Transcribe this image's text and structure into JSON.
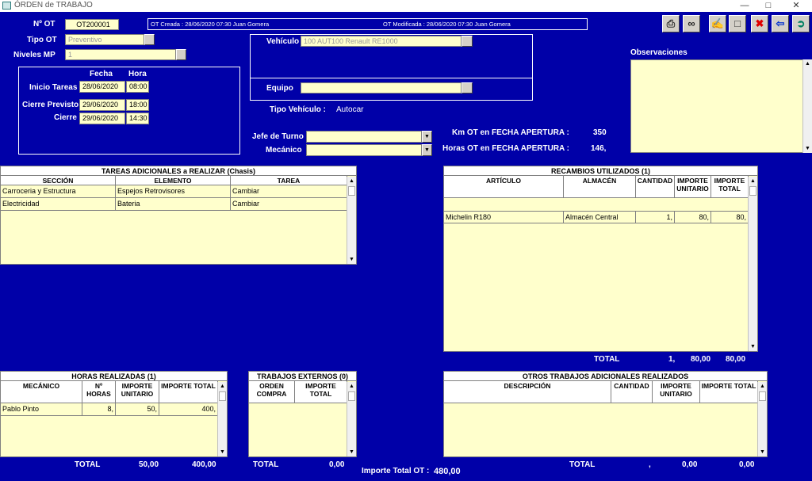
{
  "window": {
    "title": "ÓRDEN de TRABAJO"
  },
  "header": {
    "ot_label": "Nº OT",
    "ot_value": "OT200001",
    "created": "OT Creada : 28/06/2020 07:30 Juan Gomera",
    "modified": "OT Modificada : 28/06/2020 07:30 Juan Gomera",
    "tipo_label": "Tipo OT",
    "tipo_value": "Preventivo",
    "niveles_label": "Niveles MP",
    "niveles_value": "1"
  },
  "dates": {
    "fecha_label": "Fecha",
    "hora_label": "Hora",
    "inicio_label": "Inicio Tareas",
    "inicio_fecha": "28/06/2020",
    "inicio_hora": "08:00",
    "previsto_label": "Cierre Previsto",
    "previsto_fecha": "29/06/2020",
    "previsto_hora": "18:00",
    "cierre_label": "Cierre",
    "cierre_fecha": "29/06/2020",
    "cierre_hora": "14:30"
  },
  "vehicle": {
    "vehiculo_label": "Vehículo",
    "vehiculo_value": "100   AUT100 Renault RE1000",
    "equipo_label": "Equipo",
    "equipo_value": "",
    "tipo_label": "Tipo Vehículo :",
    "tipo_value": "Autocar"
  },
  "staff": {
    "jefe_label": "Jefe de Turno",
    "jefe_value": "",
    "mecanico_label": "Mecánico",
    "mecanico_value": ""
  },
  "km": {
    "km_label": "Km OT en FECHA APERTURA :",
    "km_value": "350",
    "horas_label": "Horas OT en FECHA APERTURA :",
    "horas_value": "146,"
  },
  "observaciones": {
    "label": "Observaciones",
    "value": ""
  },
  "tareas": {
    "title": "TAREAS ADICIONALES a REALIZAR (Chasis)",
    "columns": [
      "SECCIÓN",
      "ELEMENTO",
      "TAREA"
    ],
    "rows": [
      [
        "Carroceria y Estructura",
        "Espejos Retrovisores",
        "Cambiar"
      ],
      [
        "Electricidad",
        "Bateria",
        "Cambiar"
      ]
    ]
  },
  "recambios": {
    "title": "RECAMBIOS UTILIZADOS (1)",
    "columns": [
      "ARTÍCULO",
      "ALMACÉN",
      "CANTIDAD",
      "IMPORTE UNITARIO",
      "IMPORTE TOTAL"
    ],
    "rows": [
      [
        "Michelin R180",
        "Almacén Central",
        "1,",
        "80,",
        "80,"
      ]
    ],
    "total_label": "TOTAL",
    "total_cantidad": "1,",
    "total_unitario": "80,00",
    "total_total": "80,00"
  },
  "horas": {
    "title": "HORAS REALIZADAS (1)",
    "columns": [
      "MECÁNICO",
      "Nº HORAS",
      "IMPORTE UNITARIO",
      "IMPORTE TOTAL"
    ],
    "rows": [
      [
        "Pablo Pinto",
        "8,",
        "50,",
        "400,"
      ]
    ],
    "total_label": "TOTAL",
    "total_unitario": "50,00",
    "total_total": "400,00"
  },
  "externos": {
    "title": "TRABAJOS EXTERNOS (0)",
    "columns": [
      "ORDEN COMPRA",
      "IMPORTE TOTAL"
    ],
    "total_label": "TOTAL",
    "total_value": "0,00"
  },
  "otros": {
    "title": "OTROS TRABAJOS ADICIONALES REALIZADOS",
    "columns": [
      "DESCRIPCIÓN",
      "CANTIDAD",
      "IMPORTE UNITARIO",
      "IMPORTE TOTAL"
    ],
    "total_label": "TOTAL",
    "total_cantidad": ",",
    "total_unitario": "0,00",
    "total_total": "0,00"
  },
  "importe_total": {
    "label": "Importe Total OT :",
    "value": "480,00"
  },
  "toolbar": {
    "icons": [
      "printer-icon",
      "binoculars-icon",
      "sign-icon",
      "new-page-icon",
      "delete-icon",
      "back-icon",
      "exit-icon"
    ]
  }
}
